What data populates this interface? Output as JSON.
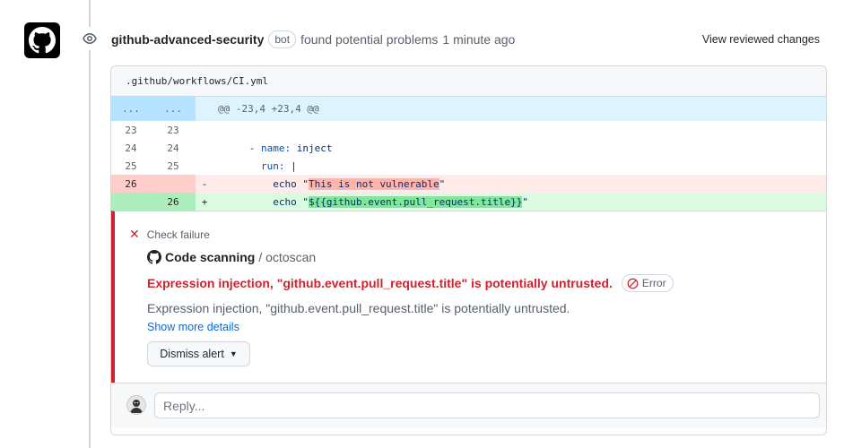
{
  "comment": {
    "author": "github-advanced-security",
    "bot_label": "bot",
    "action_text": "found potential problems",
    "time": "1 minute ago",
    "view_changes": "View reviewed changes"
  },
  "file": {
    "path": ".github/workflows/CI.yml"
  },
  "diff": {
    "hunk": {
      "left": "...",
      "right": "...",
      "header": "@@ -23,4 +23,4 @@"
    },
    "lines": [
      {
        "old": "23",
        "new": "23",
        "marker": "",
        "type": "ctx",
        "indent": "",
        "key": "",
        "value": ""
      },
      {
        "old": "24",
        "new": "24",
        "marker": "",
        "type": "ctx",
        "indent": "      - ",
        "key": "name:",
        "value": " inject"
      },
      {
        "old": "25",
        "new": "25",
        "marker": "",
        "type": "ctx",
        "indent": "        ",
        "key": "run:",
        "value": " |"
      },
      {
        "old": "26",
        "new": "",
        "marker": "-",
        "type": "del",
        "prefix": "          echo \"",
        "highlight": "This is not vulnerable",
        "suffix": "\""
      },
      {
        "old": "",
        "new": "26",
        "marker": "+",
        "type": "add",
        "prefix": "          echo \"",
        "highlight": "${{github.event.pull_request.title}}",
        "suffix": "\""
      }
    ]
  },
  "alert": {
    "check_label": "Check failure",
    "tool_name": "Code scanning",
    "tool_sub": "/ octoscan",
    "title": "Expression injection, \"github.event.pull_request.title\" is potentially untrusted.",
    "severity": "Error",
    "description": "Expression injection, \"github.event.pull_request.title\" is potentially untrusted.",
    "more_link": "Show more details",
    "dismiss_label": "Dismiss alert"
  },
  "reply": {
    "placeholder": "Reply..."
  },
  "colors": {
    "danger": "#cf222e",
    "link": "#0969da",
    "border": "#d0d7de"
  }
}
